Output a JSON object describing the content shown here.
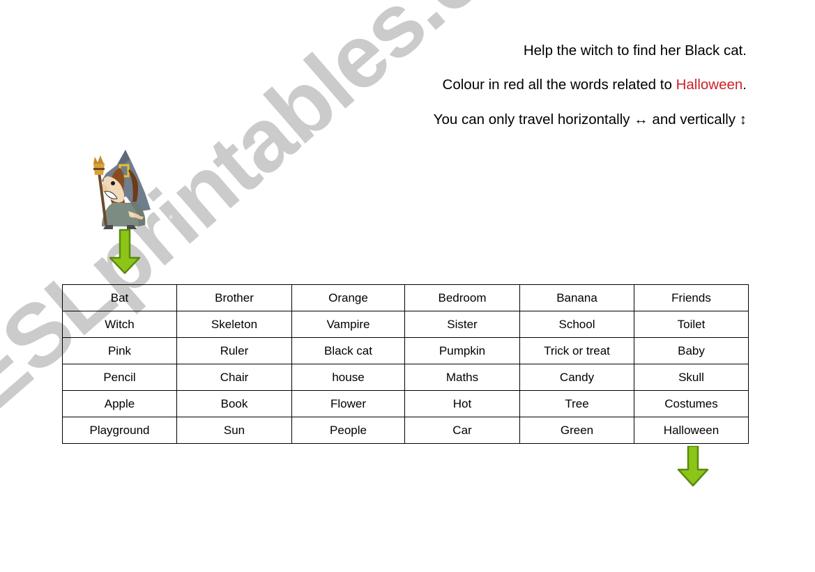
{
  "worksheet": {
    "instructions": [
      {
        "id": "line-1",
        "parts": [
          {
            "text": "Help the witch to find her Black cat.",
            "color": "#000000"
          }
        ]
      },
      {
        "id": "line-2",
        "prefix": "Colour in red all the words related to ",
        "highlight": "Halloween",
        "highlight_color": "#cc2229",
        "suffix": "."
      },
      {
        "id": "line-3",
        "prefix": "You can only travel horizontally ",
        "h_arrow": "↔",
        "middle": " and vertically ",
        "v_arrow": "↕"
      }
    ],
    "illustration": {
      "name": "witch-with-broom",
      "hat_color": "#6f7d8c",
      "hat_buckle_color": "#e8c02a",
      "hair_color": "#8a4b1e",
      "robe_color": "#7d8c82",
      "skin_color": "#f2d9b8",
      "broom_color": "#6b4a2a"
    },
    "arrows": [
      {
        "name": "start-arrow",
        "direction": "down",
        "color": "#8cc518",
        "outline": "#5a8a10"
      },
      {
        "name": "end-arrow",
        "direction": "down",
        "color": "#8cc518",
        "outline": "#5a8a10"
      }
    ],
    "grid": {
      "rows": 6,
      "cols": 6,
      "cells": [
        [
          "Bat",
          "Brother",
          "Orange",
          "Bedroom",
          "Banana",
          "Friends"
        ],
        [
          "Witch",
          "Skeleton",
          "Vampire",
          "Sister",
          "School",
          "Toilet"
        ],
        [
          "Pink",
          "Ruler",
          "Black cat",
          "Pumpkin",
          "Trick or treat",
          "Baby"
        ],
        [
          "Pencil",
          "Chair",
          "house",
          "Maths",
          "Candy",
          "Skull"
        ],
        [
          "Apple",
          "Book",
          "Flower",
          "Hot",
          "Tree",
          "Costumes"
        ],
        [
          "Playground",
          "Sun",
          "People",
          "Car",
          "Green",
          "Halloween"
        ]
      ]
    },
    "watermark": {
      "text": "ESLprintables.com",
      "color": "#cbcbcb"
    }
  }
}
